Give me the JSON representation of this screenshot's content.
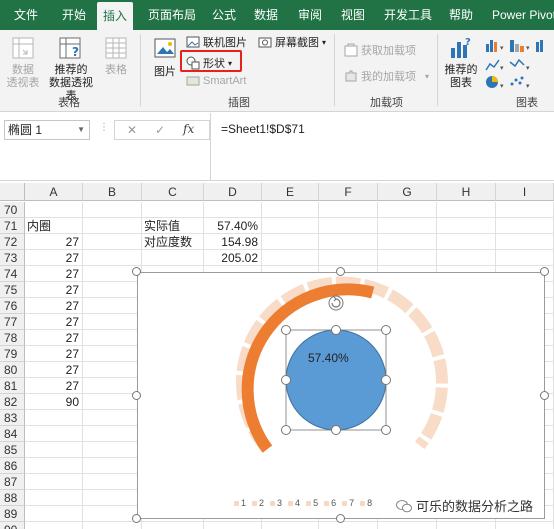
{
  "tabs": [
    "文件",
    "开始",
    "插入",
    "页面布局",
    "公式",
    "数据",
    "审阅",
    "视图",
    "开发工具",
    "帮助",
    "Power Pivot"
  ],
  "active_tab": "插入",
  "ribbon": {
    "tables": {
      "pivot": "数据\n透视表",
      "recommended_pivot": "推荐的\n数据透视表",
      "table": "表格",
      "label": "表格"
    },
    "illustrations": {
      "picture": "图片",
      "online_picture": "联机图片",
      "shapes": "形状",
      "smartart": "SmartArt",
      "screenshot": "屏幕截图",
      "label": "插图"
    },
    "addins": {
      "get": "获取加载项",
      "my": "我的加载项",
      "label": "加载项"
    },
    "charts": {
      "recommended": "推荐的\n图表",
      "label": "图表"
    }
  },
  "formula_bar": {
    "name_box": "椭圆 1",
    "cancel": "✕",
    "enter": "✓",
    "fx": "fx",
    "formula": "=Sheet1!$D$71"
  },
  "columns": [
    "A",
    "B",
    "C",
    "D",
    "E",
    "F",
    "G",
    "H",
    "I"
  ],
  "rows": [
    {
      "n": "70",
      "A": "",
      "C": "",
      "D": ""
    },
    {
      "n": "71",
      "A": "内圈",
      "C": "实际值",
      "D": "57.40%"
    },
    {
      "n": "72",
      "A": "27",
      "C": "对应度数",
      "D": "154.98"
    },
    {
      "n": "73",
      "A": "27",
      "C": "",
      "D": "205.02"
    },
    {
      "n": "74",
      "A": "27",
      "C": "",
      "D": ""
    },
    {
      "n": "75",
      "A": "27",
      "C": "",
      "D": ""
    },
    {
      "n": "76",
      "A": "27",
      "C": "",
      "D": ""
    },
    {
      "n": "77",
      "A": "27",
      "C": "",
      "D": ""
    },
    {
      "n": "78",
      "A": "27",
      "C": "",
      "D": ""
    },
    {
      "n": "79",
      "A": "27",
      "C": "",
      "D": ""
    },
    {
      "n": "80",
      "A": "27",
      "C": "",
      "D": ""
    },
    {
      "n": "81",
      "A": "27",
      "C": "",
      "D": ""
    },
    {
      "n": "82",
      "A": "90",
      "C": "",
      "D": ""
    },
    {
      "n": "83",
      "A": "",
      "C": "",
      "D": ""
    },
    {
      "n": "84",
      "A": "",
      "C": "",
      "D": ""
    },
    {
      "n": "85",
      "A": "",
      "C": "",
      "D": ""
    },
    {
      "n": "86",
      "A": "",
      "C": "",
      "D": ""
    },
    {
      "n": "87",
      "A": "",
      "C": "",
      "D": ""
    },
    {
      "n": "88",
      "A": "",
      "C": "",
      "D": ""
    },
    {
      "n": "89",
      "A": "",
      "C": "",
      "D": ""
    },
    {
      "n": "90",
      "A": "",
      "C": "",
      "D": ""
    }
  ],
  "chart": {
    "value_label": "57.40%",
    "legend": [
      "1",
      "2",
      "3",
      "4",
      "5",
      "6",
      "7",
      "8"
    ],
    "colors": {
      "arc": "#ed7d31",
      "track": "#f8dcc8",
      "circle": "#5b9bd5"
    }
  },
  "watermark": "可乐的数据分析之路"
}
